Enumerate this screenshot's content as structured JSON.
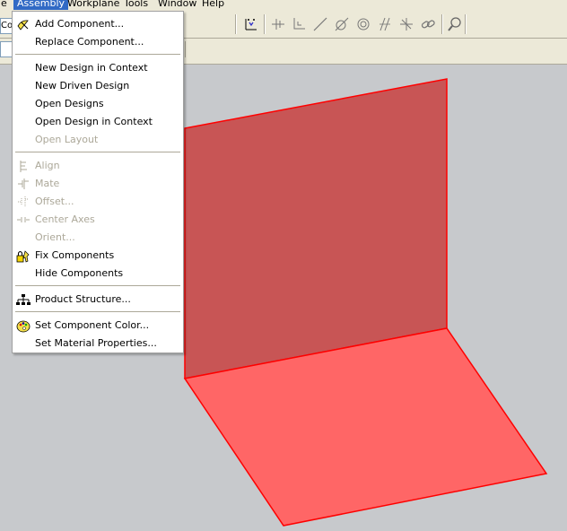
{
  "menubar": {
    "items": [
      {
        "label": "e"
      },
      {
        "label": "Assembly"
      },
      {
        "label": "Workplane"
      },
      {
        "label": "Tools"
      },
      {
        "label": "Window"
      },
      {
        "label": "Help"
      }
    ]
  },
  "toolbar": {
    "combo_text": "Co"
  },
  "assembly_menu": {
    "groups": [
      [
        {
          "label": "Add Component...",
          "enabled": true,
          "icon": "add-component-icon"
        },
        {
          "label": "Replace Component...",
          "enabled": true
        }
      ],
      [
        {
          "label": "New Design in Context",
          "enabled": true
        },
        {
          "label": "New Driven Design",
          "enabled": true
        },
        {
          "label": "Open Designs",
          "enabled": true
        },
        {
          "label": "Open Design in Context",
          "enabled": true
        },
        {
          "label": "Open Layout",
          "enabled": false
        }
      ],
      [
        {
          "label": "Align",
          "enabled": false,
          "icon": "align-icon"
        },
        {
          "label": "Mate",
          "enabled": false,
          "icon": "mate-icon"
        },
        {
          "label": "Offset...",
          "enabled": false,
          "icon": "offset-icon"
        },
        {
          "label": "Center Axes",
          "enabled": false,
          "icon": "center-axes-icon"
        },
        {
          "label": "Orient...",
          "enabled": false
        },
        {
          "label": "Fix Components",
          "enabled": true,
          "icon": "fix-components-icon"
        },
        {
          "label": "Hide Components",
          "enabled": true
        }
      ],
      [
        {
          "label": "Product Structure...",
          "enabled": true,
          "icon": "product-structure-icon"
        }
      ],
      [
        {
          "label": "Set Component Color...",
          "enabled": true,
          "icon": "component-color-icon"
        },
        {
          "label": "Set Material Properties...",
          "enabled": true
        }
      ]
    ]
  },
  "colors": {
    "menu_highlight": "#316ac5",
    "chrome": "#ece9d8",
    "viewport_bg": "#c7c9cc",
    "plate_vertical": "#c85555",
    "plate_horizontal": "#ff6666",
    "edge": "#ff0000"
  }
}
